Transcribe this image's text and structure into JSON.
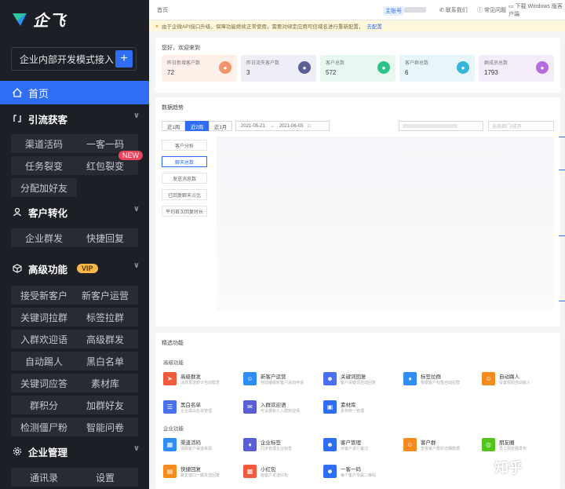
{
  "sidebar": {
    "brand": "企飞",
    "corp_name": "企业内部开发模式接入",
    "corp_add": "+",
    "home": "首页",
    "sections": [
      {
        "title": "引流获客",
        "items": [
          "渠道活码",
          "一客一码",
          "任务裂变",
          "红包裂变",
          "分配加好友"
        ],
        "badge_item": "红包裂变",
        "badge": "NEW"
      },
      {
        "title": "客户转化",
        "items": [
          "企业群发",
          "快捷回复"
        ]
      },
      {
        "title": "高级功能",
        "badge": "VIP",
        "items": [
          "接受新客户",
          "新客户运营",
          "关键词拉群",
          "标签拉群",
          "入群欢迎语",
          "高级群发",
          "自动踢人",
          "黑白名单",
          "关键词应答",
          "素材库",
          "群积分",
          "加群好友",
          "检测僵尸粉",
          "智能问卷"
        ]
      },
      {
        "title": "企业管理",
        "items": [
          "通讯录",
          "设置"
        ]
      }
    ]
  },
  "topbar": {
    "home": "首页",
    "tag": "主账号",
    "contact": "联系我们",
    "faq": "常见问题",
    "download": "下载 Windows 版客户端"
  },
  "notice": {
    "text": "由于企微API接口升级，保障功能继续正常使用，需要对绑定应用可信域名进行重新配置，",
    "link": "去配置"
  },
  "welcome": {
    "title": "您好，欢迎来到",
    "stats": [
      {
        "label": "昨日新增客户数",
        "value": "72",
        "color": "#f2936b"
      },
      {
        "label": "昨日流失客户数",
        "value": "3",
        "color": "#5b5f94"
      },
      {
        "label": "客户总数",
        "value": "572",
        "color": "#2ec28b"
      },
      {
        "label": "客户群总数",
        "value": "6",
        "color": "#36b5d9"
      },
      {
        "label": "群成员总数",
        "value": "1793",
        "color": "#b36cd9"
      }
    ]
  },
  "data_analysis": {
    "title": "数据趋势",
    "ranges": [
      "近1周",
      "近2周",
      "近1月"
    ],
    "active_range": "近2周",
    "date_start": "2021-05-21",
    "date_sep": "→",
    "date_end": "2021-06-03",
    "dept_placeholder": "选择部门/成员",
    "metrics": [
      "客户分析",
      "聊天总数",
      "发送消息数",
      "已回复聊天占比",
      "平均首次回复时长"
    ],
    "active_metric": "聊天总数"
  },
  "features": {
    "title": "精选功能",
    "groups": [
      {
        "name": "高级功能",
        "items": [
          {
            "name": "高级群发",
            "desc": "消息发送统计自动群发",
            "color": "#f05a3d"
          },
          {
            "name": "新客户运营",
            "desc": "自动播报新客户添加申请",
            "color": "#2f8df5"
          },
          {
            "name": "关键词回复",
            "desc": "客户关键词自动回复",
            "color": "#4a6ff0"
          },
          {
            "name": "标签拉群",
            "desc": "根据客户标签自动拉群",
            "color": "#2f8df5"
          },
          {
            "name": "自动踢人",
            "desc": "设置规则自动踢人",
            "color": "#f58a1f"
          },
          {
            "name": "黑白名单",
            "desc": "企业黑白名单管理",
            "color": "#4a6ff0"
          },
          {
            "name": "入群欢迎语",
            "desc": "可设置新人入群欢迎语",
            "color": "#5b5fd6"
          },
          {
            "name": "素材库",
            "desc": "素材统一管理",
            "color": "#2f6df5"
          }
        ]
      },
      {
        "name": "企业功能",
        "items": [
          {
            "name": "渠道活码",
            "desc": "追踪客户渠道来源",
            "color": "#2f8df5"
          },
          {
            "name": "企业标签",
            "desc": "同步管理企业标签",
            "color": "#5b5fd6"
          },
          {
            "name": "客户管理",
            "desc": "对客户进行备注",
            "color": "#2f6df5"
          },
          {
            "name": "客户群",
            "desc": "查看客户群的详细数据",
            "color": "#f58a1f"
          },
          {
            "name": "朋友圈",
            "desc": "员工朋友圈发布",
            "color": "#52c41a"
          },
          {
            "name": "快捷回复",
            "desc": "聊天窗口一键发送回复",
            "color": "#f58a1f"
          },
          {
            "name": "小红包",
            "desc": "给客户发送红包",
            "color": "#f05a3d"
          },
          {
            "name": "一客一码",
            "desc": "每个客户专属二维码",
            "color": "#2f6df5"
          }
        ]
      }
    ]
  },
  "watermark": "知乎"
}
